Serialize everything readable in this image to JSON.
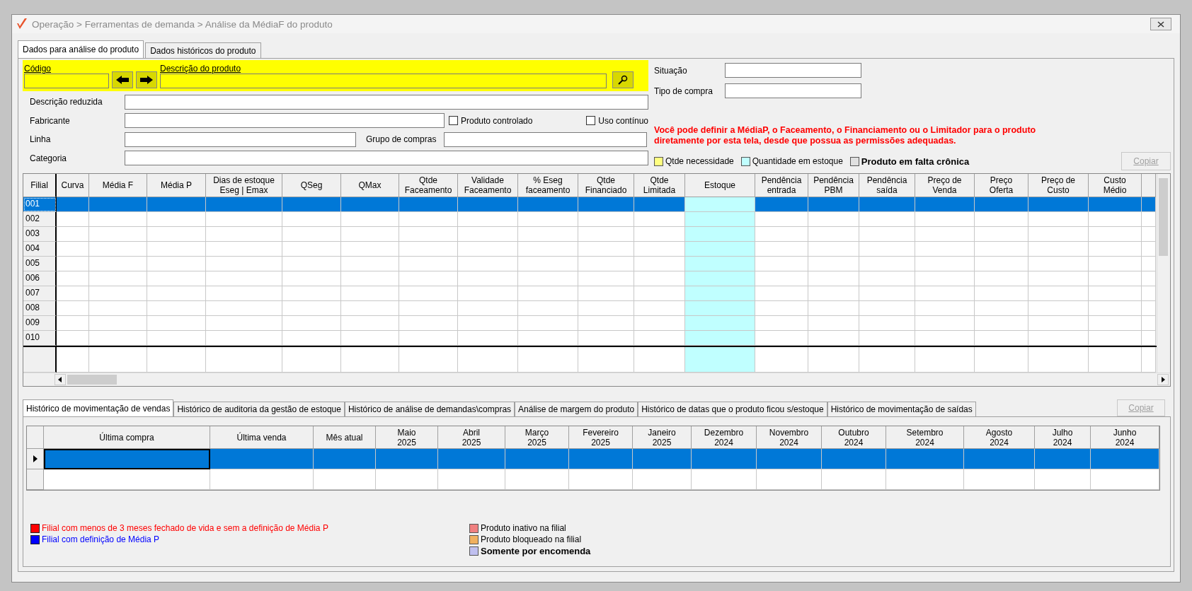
{
  "window": {
    "title": "Operação > Ferramentas de demanda > Análise da MédiaF do produto"
  },
  "tabs": [
    {
      "label": "Dados para análise do produto",
      "selected": true
    },
    {
      "label": "Dados históricos do produto",
      "selected": false
    }
  ],
  "search": {
    "code_label": "Código",
    "description_label": "Descrição do produto"
  },
  "status_fields": [
    {
      "label": "Situação"
    },
    {
      "label": "Tipo de compra"
    }
  ],
  "fields": {
    "short_description": "Descrição reduzida",
    "manufacturer": "Fabricante",
    "line": "Linha",
    "purchase_group": "Grupo de compras",
    "category": "Categoria"
  },
  "checkboxes": [
    {
      "label": "Produto controlado",
      "checked": false
    },
    {
      "label": "Uso contínuo",
      "checked": false
    }
  ],
  "notice": "Você pode definir a MédiaP, o Faceamento, o Financiamento ou o Limitador para o produto diretamente por esta tela, desde que possua as permissões adequadas.",
  "color_legend": [
    {
      "label": "Qtde necessidade",
      "color": "#ffff80",
      "bold": false
    },
    {
      "label": "Quantidade em estoque",
      "color": "#c0ffff",
      "bold": false
    },
    {
      "label": "Produto em falta crônica",
      "color": "#e0e0e0",
      "bold": true
    }
  ],
  "copy_button": {
    "label": "Copiar",
    "disabled": true
  },
  "grid": {
    "columns": [
      {
        "label": "Filial"
      },
      {
        "label": "Curva"
      },
      {
        "label": "Média F"
      },
      {
        "label": "Média P"
      },
      {
        "label": "Dias de estoque\nEseg | Emax"
      },
      {
        "label": "QSeg"
      },
      {
        "label": "QMax"
      },
      {
        "label": "Qtde\nFaceamento"
      },
      {
        "label": "Validade\nFaceamento"
      },
      {
        "label": "% Eseg\nfaceamento"
      },
      {
        "label": "Qtde\nFinanciado"
      },
      {
        "label": "Qtde\nLimitada"
      },
      {
        "label": "Estoque",
        "color": "#c0ffff"
      },
      {
        "label": "Pendência\nentrada"
      },
      {
        "label": "Pendência\nPBM"
      },
      {
        "label": "Pendência\nsaída"
      },
      {
        "label": "Preço de\nVenda"
      },
      {
        "label": "Preço\nOferta"
      },
      {
        "label": "Preço de\nCusto"
      },
      {
        "label": "Custo\nMédio"
      }
    ],
    "rows": [
      {
        "filial": "001",
        "selected": true
      },
      {
        "filial": "002",
        "selected": false
      },
      {
        "filial": "003",
        "selected": false
      },
      {
        "filial": "004",
        "selected": false
      },
      {
        "filial": "005",
        "selected": false
      },
      {
        "filial": "006",
        "selected": false
      },
      {
        "filial": "007",
        "selected": false
      },
      {
        "filial": "008",
        "selected": false
      },
      {
        "filial": "009",
        "selected": false
      },
      {
        "filial": "010",
        "selected": false
      }
    ]
  },
  "history_tabs": [
    {
      "label": "Histórico de movimentação de vendas",
      "selected": true
    },
    {
      "label": "Histórico de auditoria da gestão de estoque",
      "selected": false
    },
    {
      "label": "Histórico de análise de demandas\\compras",
      "selected": false
    },
    {
      "label": "Análise de margem do produto",
      "selected": false
    },
    {
      "label": "Histórico de datas que o produto ficou s/estoque",
      "selected": false
    },
    {
      "label": "Histórico de movimentação de saídas",
      "selected": false
    }
  ],
  "history_copy_button": {
    "label": "Copiar",
    "disabled": true
  },
  "history_grid": {
    "columns": [
      {
        "label": "Última compra"
      },
      {
        "label": "Última venda"
      },
      {
        "label": "Mês atual"
      },
      {
        "label": "Maio\n2025"
      },
      {
        "label": "Abril\n2025"
      },
      {
        "label": "Março\n2025"
      },
      {
        "label": "Fevereiro\n2025"
      },
      {
        "label": "Janeiro\n2025"
      },
      {
        "label": "Dezembro\n2024"
      },
      {
        "label": "Novembro\n2024"
      },
      {
        "label": "Outubro\n2024"
      },
      {
        "label": "Setembro\n2024"
      },
      {
        "label": "Agosto\n2024"
      },
      {
        "label": "Julho\n2024"
      },
      {
        "label": "Junho\n2024"
      }
    ],
    "rows": [
      {
        "selected": true
      },
      {
        "selected": false
      }
    ]
  },
  "branch_legend": [
    {
      "label": "Filial com menos de 3 meses fechado de vida e sem a definição de Média P",
      "color": "#ff0000"
    },
    {
      "label": "Filial com definição de Média P",
      "color": "#0000ff"
    }
  ],
  "product_legend": [
    {
      "label": "Produto inativo na filial",
      "color": "#f08080",
      "bold": false
    },
    {
      "label": "Produto bloqueado na filial",
      "color": "#f0b060",
      "bold": false
    },
    {
      "label": "Somente por encomenda",
      "color": "#c0c0f0",
      "bold": true
    }
  ]
}
